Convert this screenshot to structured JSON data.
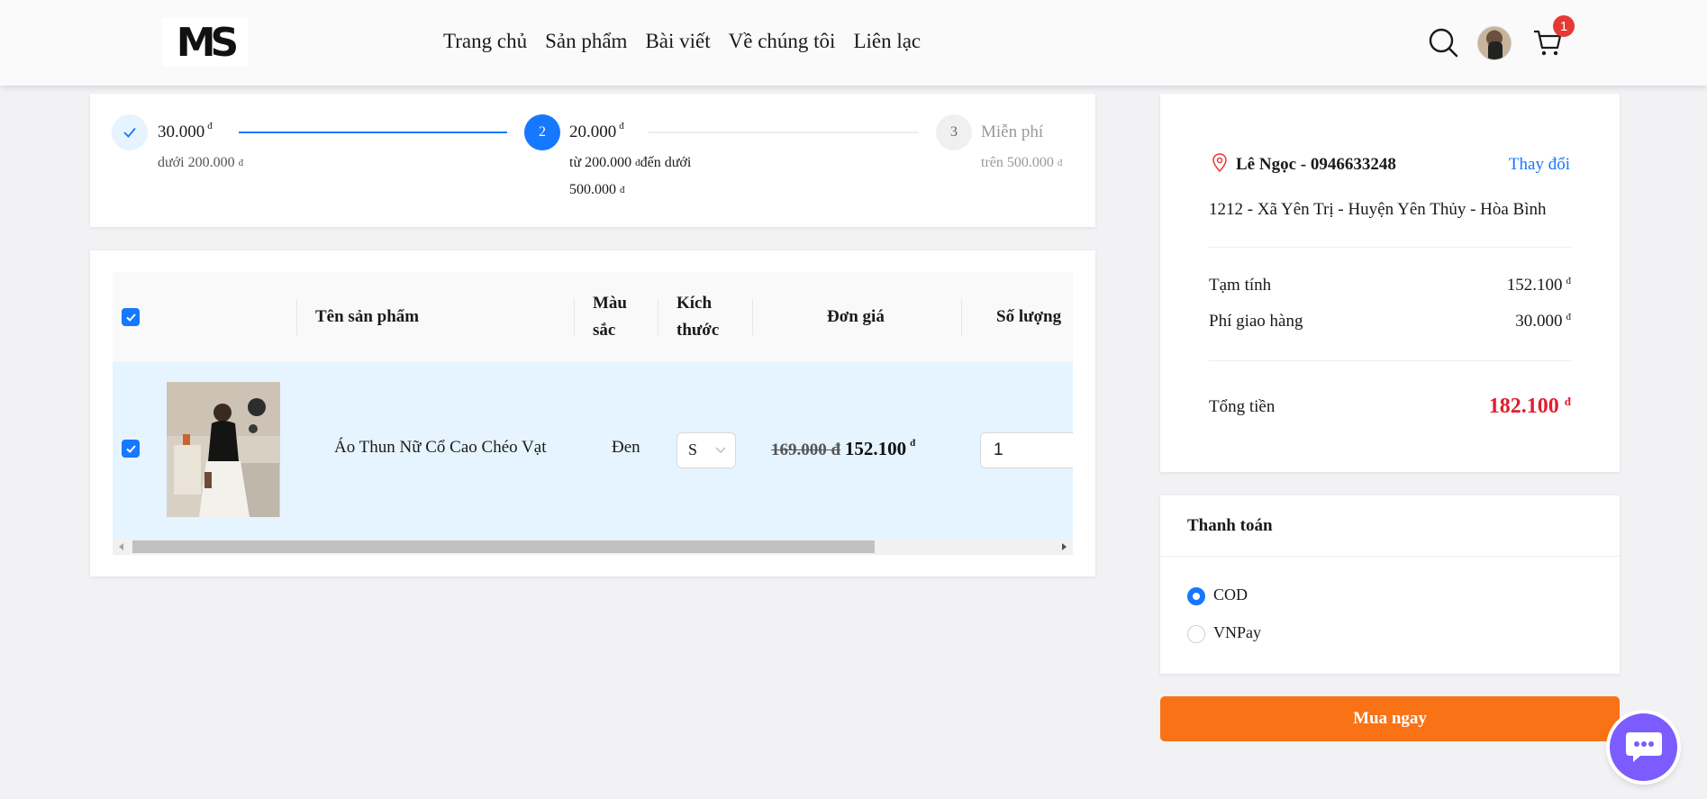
{
  "header": {
    "logo_text": "MS",
    "nav": [
      "Trang chủ",
      "Sản phẩm",
      "Bài viết",
      "Về chúng tôi",
      "Liên lạc"
    ],
    "cart_count": "1"
  },
  "shipping_steps": [
    {
      "index": "✓",
      "title": "30.000",
      "currency": "đ",
      "subtitle": "dưới 200.000 ",
      "sub_currency": "đ",
      "status": "done"
    },
    {
      "index": "2",
      "title": "20.000",
      "currency": "đ",
      "subtitle": "từ 200.000 ",
      "sub_currency": "đ",
      "subtitle_rest": "đến dưới",
      "subtitle_line2": "500.000 ",
      "sub2_currency": "đ",
      "status": "active"
    },
    {
      "index": "3",
      "title": "Miễn phí",
      "currency": "",
      "subtitle": "trên 500.000 ",
      "sub_currency": "đ",
      "status": "pending"
    }
  ],
  "cart_table": {
    "headers": {
      "name": "Tên sản phẩm",
      "color_1": "Màu",
      "color_2": "sắc",
      "size_1": "Kích",
      "size_2": "thước",
      "unit_price": "Đơn giá",
      "quantity": "Số lượng"
    },
    "row": {
      "name": "Áo Thun Nữ Cổ Cao Chéo Vạt",
      "color": "Đen",
      "size": "S",
      "old_price": "169.000 đ",
      "price": "152.100",
      "currency": "đ",
      "quantity": "1"
    }
  },
  "summary": {
    "recipient": "Lê Ngọc - 0946633248",
    "change_label": "Thay đổi",
    "address": "1212 - Xã Yên Trị - Huyện Yên Thủy - Hòa Bình",
    "subtotal_label": "Tạm tính",
    "subtotal_value": "152.100",
    "shipping_label": "Phí giao hàng",
    "shipping_value": "30.000",
    "total_label": "Tổng tiền",
    "total_value": "182.100",
    "currency": "đ"
  },
  "payment": {
    "title": "Thanh toán",
    "options": [
      "COD",
      "VNPay"
    ],
    "selected": "COD"
  },
  "buy_button": "Mua ngay",
  "colors": {
    "primary": "#1677ff",
    "accent_orange": "#f97316",
    "total_red": "#e11d2e",
    "chat_purple": "#7c5cff"
  }
}
